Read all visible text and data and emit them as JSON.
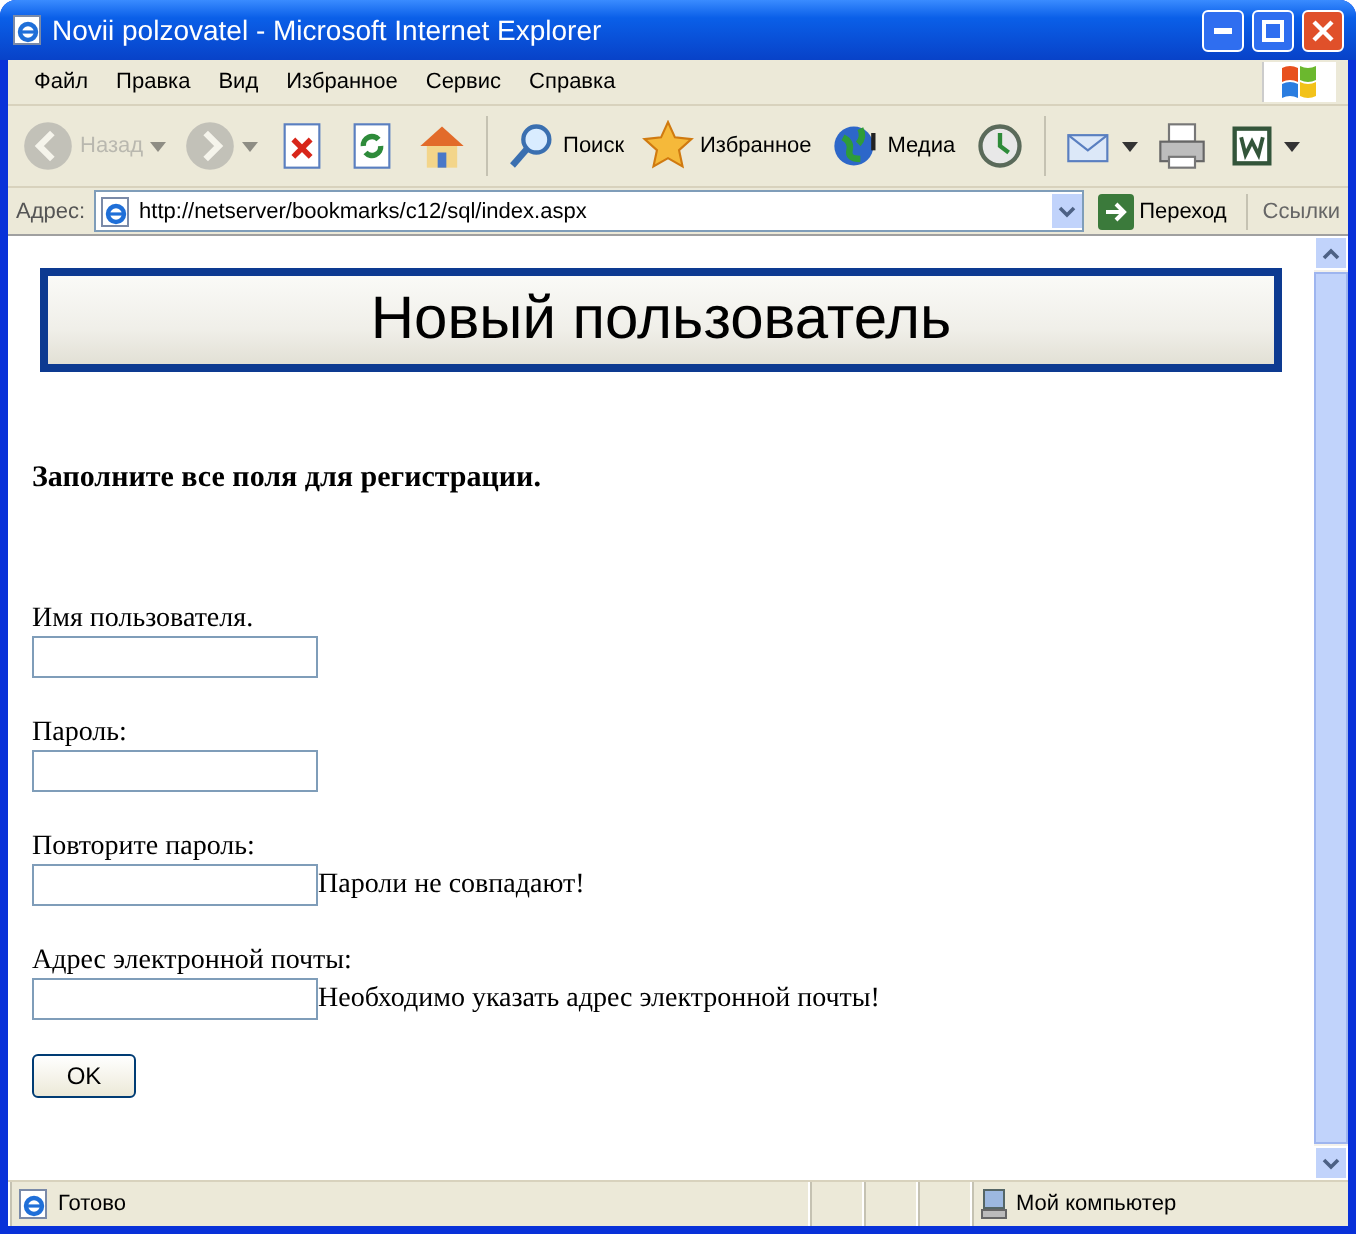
{
  "window": {
    "title": "Novii polzovatel - Microsoft Internet Explorer"
  },
  "menu": [
    "Файл",
    "Правка",
    "Вид",
    "Избранное",
    "Сервис",
    "Справка"
  ],
  "toolbar": [
    {
      "kind": "back",
      "label": "Назад",
      "disabled": true
    },
    {
      "kind": "forward",
      "disabled": true
    },
    {
      "kind": "stop",
      "disabled": false
    },
    {
      "kind": "refresh",
      "disabled": false
    },
    {
      "kind": "home",
      "disabled": false
    },
    {
      "kind": "search",
      "label": "Поиск",
      "disabled": false
    },
    {
      "kind": "favorites",
      "label": "Избранное",
      "disabled": false
    },
    {
      "kind": "media",
      "label": "Медиа",
      "disabled": false
    },
    {
      "kind": "history",
      "disabled": false
    },
    {
      "kind": "mail",
      "disabled": false
    },
    {
      "kind": "print",
      "disabled": false
    },
    {
      "kind": "word",
      "disabled": false
    }
  ],
  "address_bar": {
    "label": "Адрес:",
    "url": "http://netserver/bookmarks/c12/sql/index.aspx",
    "go": "Переход",
    "links": "Ссылки"
  },
  "page": {
    "banner": "Новый пользователь",
    "heading": "Заполните все поля для регистрации.",
    "fields": [
      {
        "label": "Имя пользователя."
      },
      {
        "label": "Пароль:"
      },
      {
        "label": "Повторите пароль:",
        "error": "Пароли не совпадают!"
      },
      {
        "label": "Адрес электронной почты:",
        "error": "Необходимо указать адрес электронной почты!"
      }
    ],
    "submit": "OK"
  },
  "status_bar": {
    "text": "Готово",
    "zone": "Мой компьютер"
  }
}
